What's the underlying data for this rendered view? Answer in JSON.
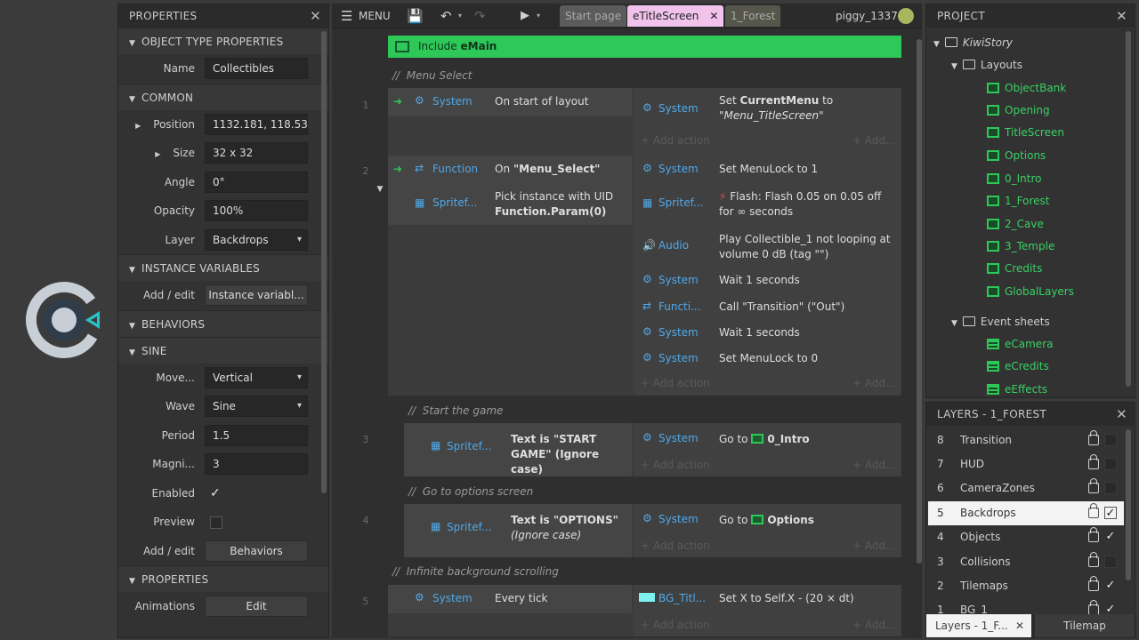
{
  "properties": {
    "title": "PROPERTIES",
    "sections": {
      "object_type": "OBJECT TYPE PROPERTIES",
      "common": "COMMON",
      "instance_vars": "INSTANCE VARIABLES",
      "behaviors": "BEHAVIORS",
      "sine": "SINE",
      "properties": "PROPERTIES"
    },
    "name": {
      "label": "Name",
      "value": "Collectibles"
    },
    "position": {
      "label": "Position",
      "value": "1132.181, 118.53"
    },
    "size": {
      "label": "Size",
      "value": "32 x 32"
    },
    "angle": {
      "label": "Angle",
      "value": "0°"
    },
    "opacity": {
      "label": "Opacity",
      "value": "100%"
    },
    "layer": {
      "label": "Layer",
      "value": "Backdrops"
    },
    "instance_vars": {
      "label": "Add / edit",
      "button": "Instance variabl..."
    },
    "sine_move": {
      "label": "Move...",
      "value": "Vertical"
    },
    "sine_wave": {
      "label": "Wave",
      "value": "Sine"
    },
    "sine_period": {
      "label": "Period",
      "value": "1.5"
    },
    "sine_magni": {
      "label": "Magni...",
      "value": "3"
    },
    "enabled": {
      "label": "Enabled",
      "checked": true
    },
    "preview": {
      "label": "Preview",
      "checked": false
    },
    "behaviors": {
      "label": "Add / edit",
      "button": "Behaviors"
    },
    "animations": {
      "label": "Animations",
      "button": "Edit"
    }
  },
  "toolbar": {
    "menu": "MENU",
    "tabs": [
      "Start page",
      "eTitleScreen",
      "1_Forest"
    ],
    "active_tab": "eTitleScreen",
    "user": "piggy_1337"
  },
  "sheet": {
    "include": {
      "prefix": "Include",
      "name": "eMain"
    },
    "comments": [
      "Menu Select",
      "Start the game",
      "Go to options screen",
      "Infinite background scrolling"
    ],
    "add_action": "Add action",
    "add_short": "Add...",
    "events": [
      {
        "num": "1",
        "cond_obj": "System",
        "cond_text": "On start of layout",
        "actions": [
          {
            "obj": "System",
            "text_a": "Set ",
            "bold": "CurrentMenu",
            "text_b": " to",
            "line2": "\"Menu_TitleScreen\""
          }
        ]
      },
      {
        "num": "2",
        "cond_obj": "Function",
        "cond_text_a": "On ",
        "cond_bold": "\"Menu_Select\"",
        "cond2_obj": "Spritef...",
        "cond2_text": "Pick instance with UID",
        "cond2_bold": "Function.Param(0)",
        "actions": [
          {
            "obj": "System",
            "text": "Set MenuLock to 1"
          },
          {
            "obj": "Spritef...",
            "text": "Flash: Flash 0.05 on 0.05 off",
            "line2": "for ∞ seconds"
          },
          {
            "obj": "Audio",
            "text": "Play Collectible_1 not looping at",
            "line2": "volume 0 dB (tag \"\")"
          },
          {
            "obj": "System",
            "text": "Wait 1 seconds"
          },
          {
            "obj": "Functi...",
            "text": "Call \"Transition\" (\"Out\")"
          },
          {
            "obj": "System",
            "text": "Wait 1 seconds"
          },
          {
            "obj": "System",
            "text": "Set MenuLock to 0"
          }
        ]
      },
      {
        "num": "3",
        "cond_obj": "Spritef...",
        "cond_text": "Text is \"START",
        "cond_line2": "GAME\" (Ignore case)",
        "actions": [
          {
            "obj": "System",
            "text": "Go to",
            "target": "0_Intro"
          }
        ]
      },
      {
        "num": "4",
        "cond_obj": "Spritef...",
        "cond_text": "Text is \"OPTIONS\"",
        "cond_line2": "(Ignore case)",
        "actions": [
          {
            "obj": "System",
            "text": "Go to",
            "target": "Options"
          }
        ]
      },
      {
        "num": "5",
        "cond_obj": "System",
        "cond_text": "Every tick",
        "actions": [
          {
            "obj": "BG_Titl...",
            "text": "Set X to Self.X - (20 × dt)"
          }
        ]
      }
    ]
  },
  "project": {
    "title": "PROJECT",
    "root": "KiwiStory",
    "layouts_folder": "Layouts",
    "layouts": [
      "ObjectBank",
      "Opening",
      "TitleScreen",
      "Options",
      "0_Intro",
      "1_Forest",
      "2_Cave",
      "3_Temple",
      "Credits",
      "GlobalLayers"
    ],
    "eventsheets_folder": "Event sheets",
    "eventsheets": [
      "eCamera",
      "eCredits",
      "eEffects"
    ]
  },
  "layers": {
    "title": "LAYERS - 1_FOREST",
    "items": [
      {
        "num": "8",
        "name": "Transition",
        "visible": false
      },
      {
        "num": "7",
        "name": "HUD",
        "visible": false
      },
      {
        "num": "6",
        "name": "CameraZones",
        "visible": false
      },
      {
        "num": "5",
        "name": "Backdrops",
        "visible": true,
        "selected": true
      },
      {
        "num": "4",
        "name": "Objects",
        "visible": true
      },
      {
        "num": "3",
        "name": "Collisions",
        "visible": false
      },
      {
        "num": "2",
        "name": "Tilemaps",
        "visible": true
      },
      {
        "num": "1",
        "name": "BG_1",
        "visible": true
      }
    ],
    "bottom_tabs": [
      "Layers - 1_F...",
      "Tilemap"
    ]
  },
  "colors": {
    "accent_green": "#2ec858",
    "object_blue": "#4fa8e8",
    "tab_pink": "#f1c3ec"
  }
}
